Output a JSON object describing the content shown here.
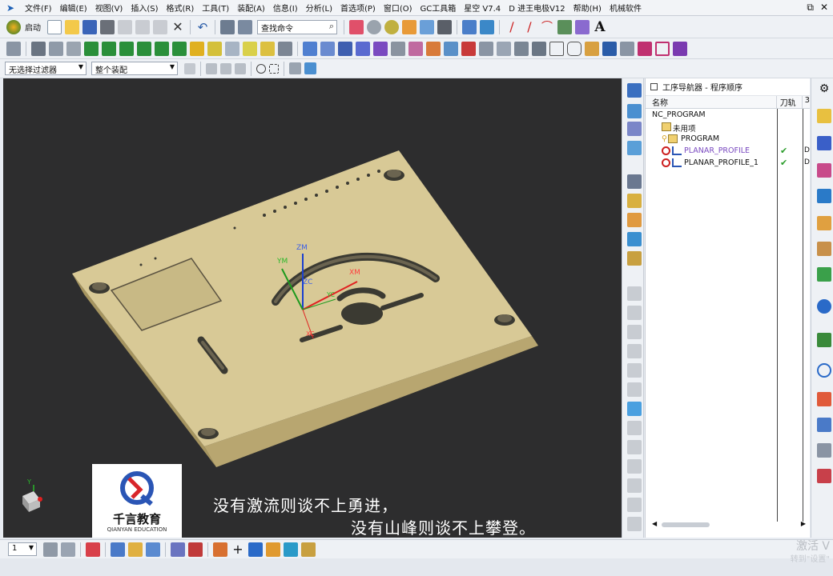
{
  "menu": {
    "items": [
      "文件(F)",
      "编辑(E)",
      "视图(V)",
      "插入(S)",
      "格式(R)",
      "工具(T)",
      "装配(A)",
      "信息(I)",
      "分析(L)",
      "首选项(P)",
      "窗口(O)",
      "GC工具箱",
      "星空 V7.4",
      "D 进王电极V12",
      "帮助(H)",
      "机械软件"
    ],
    "window_controls": [
      "⬅",
      "⧉",
      "✕"
    ]
  },
  "toolbar": {
    "start_label": "启动",
    "search_placeholder": "查找命令",
    "filter_value": "无选择过滤器",
    "scope_value": "整个装配"
  },
  "viewport": {
    "axis_labels": {
      "zm": "ZM",
      "ym": "YM",
      "xm": "XM",
      "zc": "ZC",
      "yc": "YC",
      "xc": "XC"
    },
    "caption_line1": "没有激流则谈不上勇进，",
    "caption_line2": "没有山峰则谈不上攀登。",
    "logo_brand": "千言教育",
    "logo_brand_en": "QIANYAN EDUCATION",
    "triad_y": "Y"
  },
  "navigator": {
    "title": "工序导航器 - 程序顺序",
    "col_name": "名称",
    "col_toolpath": "刀轨",
    "col_extra": "3",
    "rows": [
      {
        "name": "NC_PROGRAM",
        "status": ""
      },
      {
        "name": "未用项",
        "status": ""
      },
      {
        "name": "PROGRAM",
        "status": ""
      },
      {
        "name": "PLANAR_PROFILE",
        "status": "✔",
        "extra": "D"
      },
      {
        "name": "PLANAR_PROFILE_1",
        "status": "✔",
        "extra": "D"
      }
    ]
  },
  "bottom": {
    "layer_value": "1"
  },
  "watermark": {
    "line1": "激活 V",
    "line2": "转到\"设置\""
  },
  "colors": {
    "viewport_bg": "#2d2d2e",
    "part_top": "#d8c996",
    "part_side": "#b8a670",
    "accent_blue": "#1b5fb6",
    "check_green": "#2a9c2a",
    "error_red": "#cc1f1f"
  }
}
